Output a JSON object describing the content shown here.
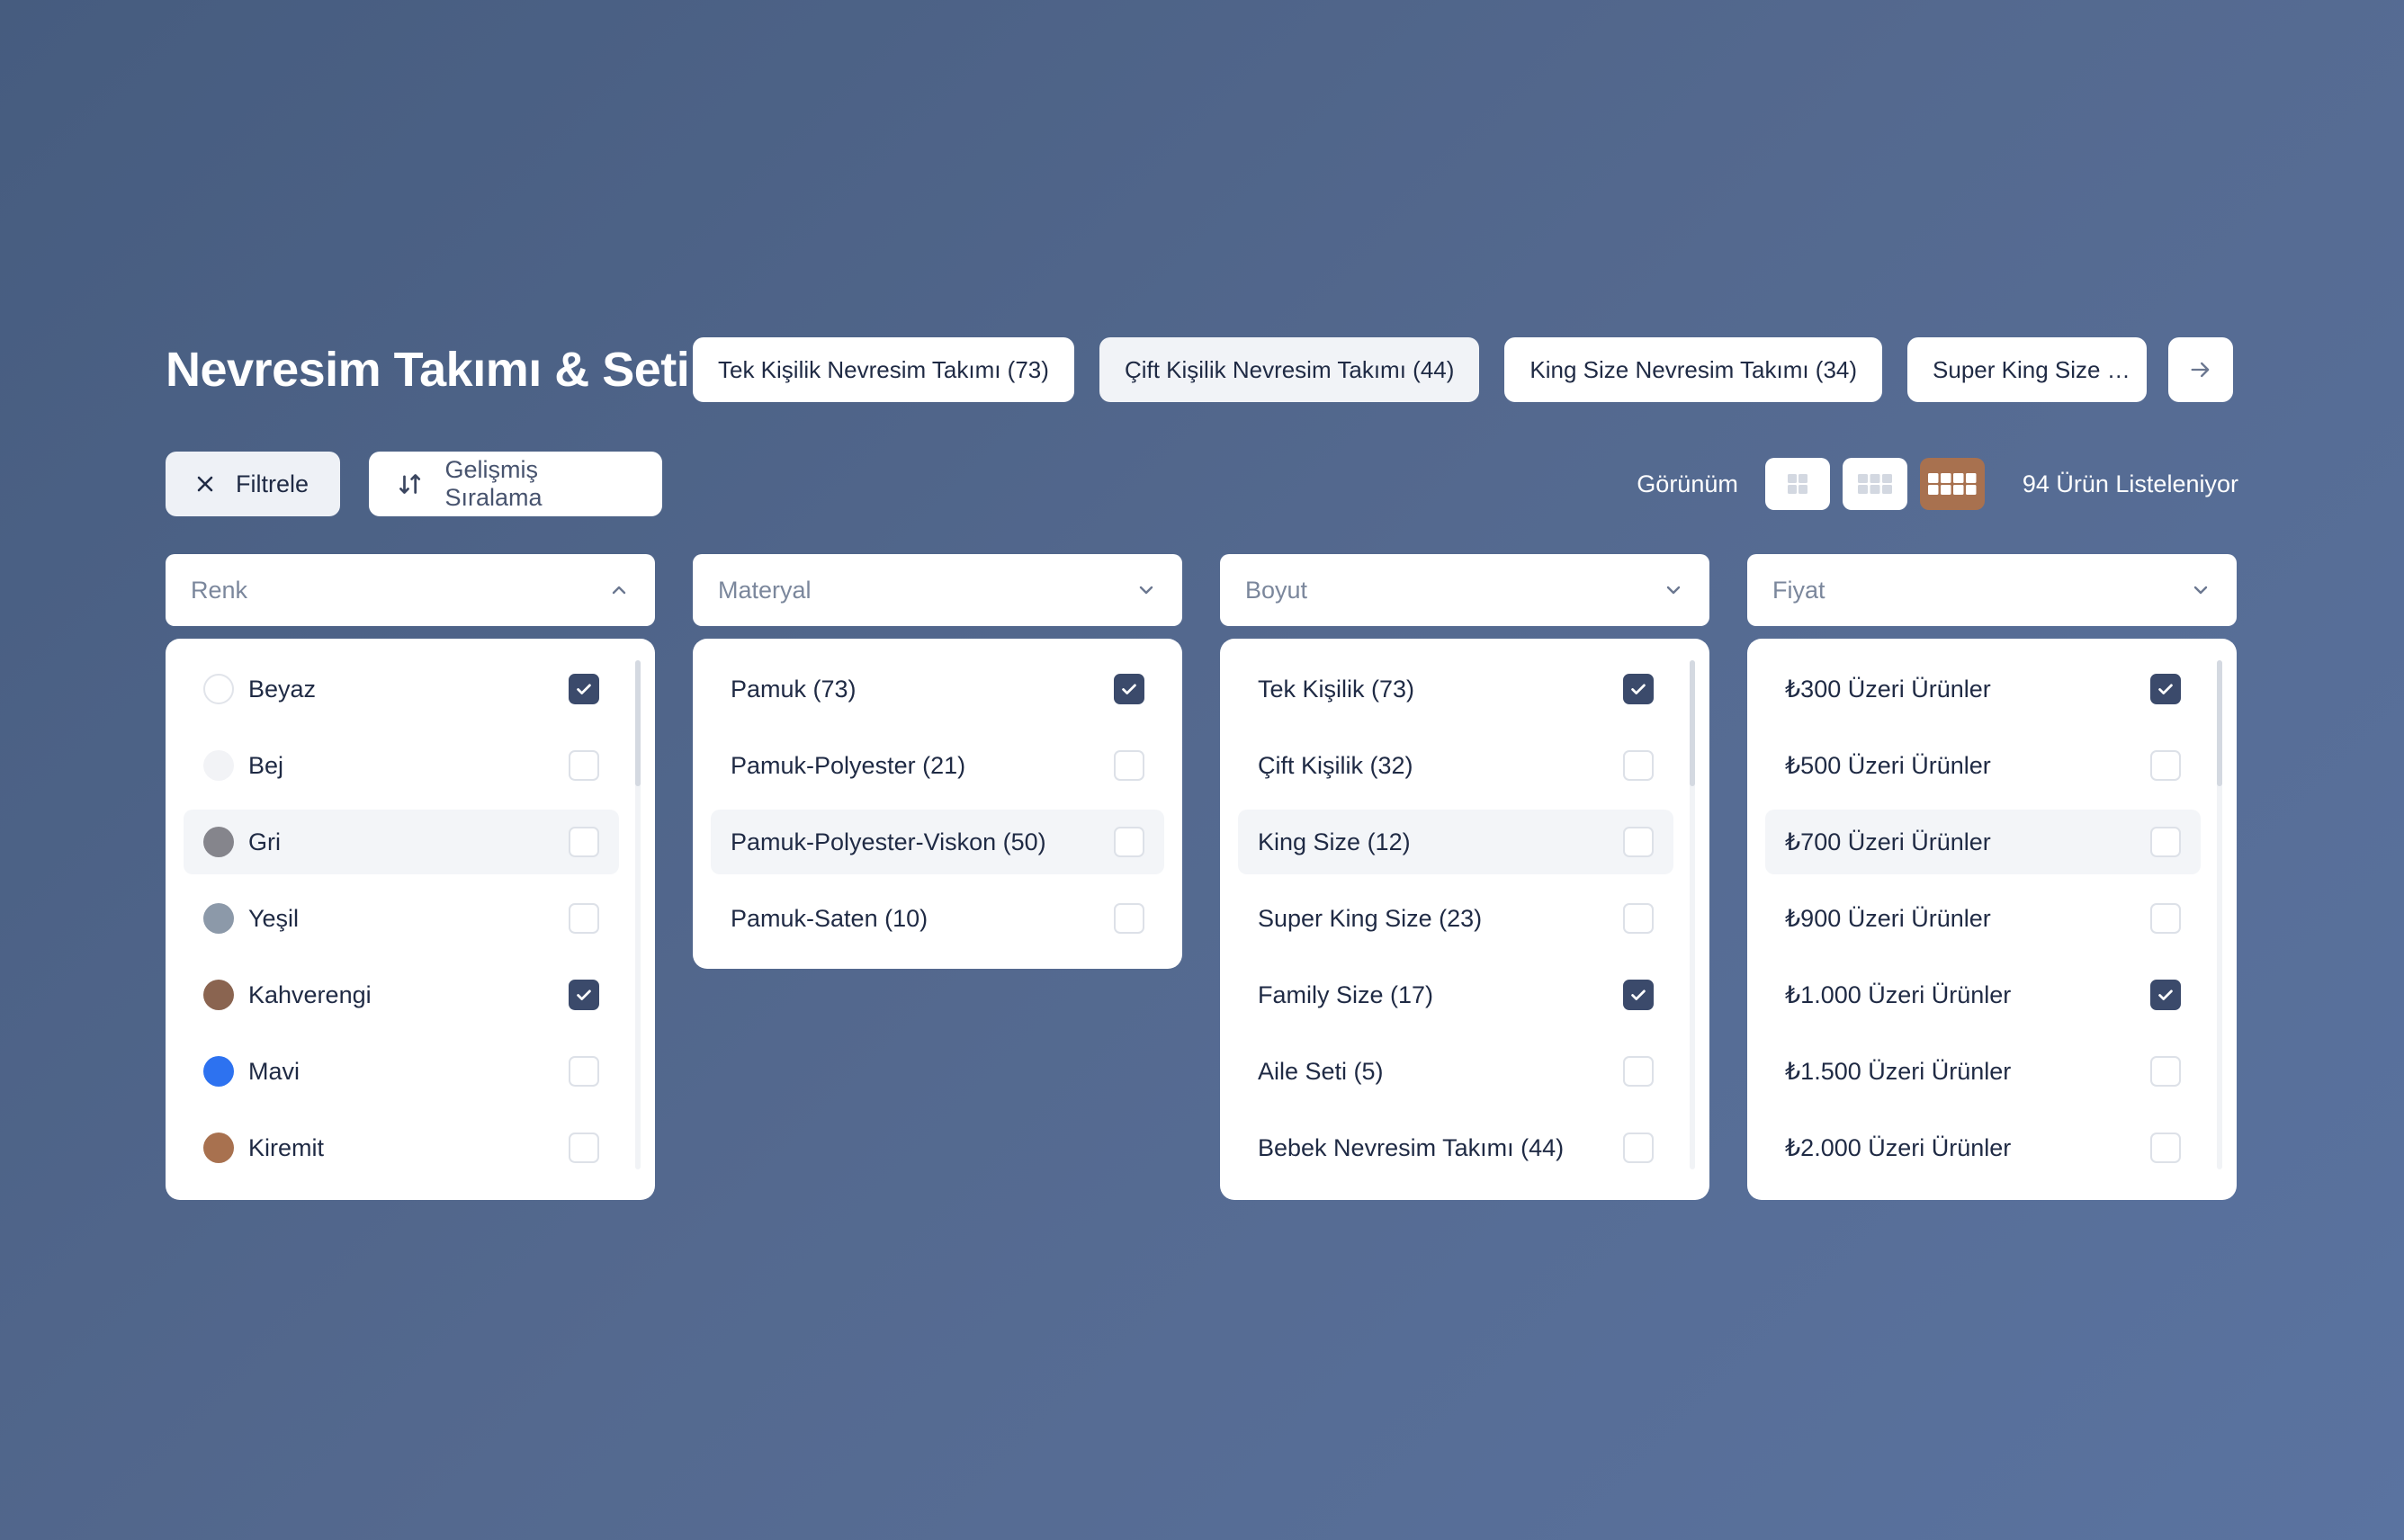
{
  "header": {
    "title": "Nevresim Takımı & Seti",
    "categories": [
      {
        "label": "Tek Kişilik Nevresim Takımı (73)"
      },
      {
        "label": "Çift Kişilik Nevresim Takımı (44)"
      },
      {
        "label": "King Size Nevresim Takımı (34)"
      },
      {
        "label": "Super King Size N..."
      }
    ],
    "next_icon": "arrow-right-icon"
  },
  "toolbar": {
    "filter_label": "Filtrele",
    "sort_label": "Gelişmiş Sıralama",
    "view_label": "Görünüm",
    "view_modes": [
      "grid-2-icon",
      "grid-3-icon",
      "grid-4-icon"
    ],
    "active_view": "grid-4-icon",
    "count_label": "94 Ürün Listeleniyor"
  },
  "filters": {
    "color": {
      "placeholder": "Renk",
      "expanded": true,
      "options": [
        {
          "label": "Beyaz",
          "swatch": "#ffffff",
          "checked": true
        },
        {
          "label": "Bej",
          "swatch": "#f2f3f6",
          "checked": false
        },
        {
          "label": "Gri",
          "swatch": "#85858c",
          "checked": false
        },
        {
          "label": "Yeşil",
          "swatch": "#8c99a9",
          "checked": false
        },
        {
          "label": "Kahverengi",
          "swatch": "#8a6450",
          "checked": true
        },
        {
          "label": "Mavi",
          "swatch": "#2d72f0",
          "checked": false
        },
        {
          "label": "Kiremit",
          "swatch": "#a8714f",
          "checked": false
        }
      ]
    },
    "material": {
      "placeholder": "Materyal",
      "options": [
        {
          "label": "Pamuk (73)",
          "checked": true
        },
        {
          "label": "Pamuk-Polyester (21)",
          "checked": false
        },
        {
          "label": "Pamuk-Polyester-Viskon (50)",
          "checked": false
        },
        {
          "label": "Pamuk-Saten (10)",
          "checked": false
        }
      ]
    },
    "size": {
      "placeholder": "Boyut",
      "options": [
        {
          "label": "Tek Kişilik (73)",
          "checked": true
        },
        {
          "label": "Çift Kişilik (32)",
          "checked": false
        },
        {
          "label": "King Size (12)",
          "checked": false
        },
        {
          "label": "Super King Size (23)",
          "checked": false
        },
        {
          "label": "Family Size (17)",
          "checked": true
        },
        {
          "label": "Aile Seti (5)",
          "checked": false
        },
        {
          "label": "Bebek Nevresim Takımı (44)",
          "checked": false
        }
      ]
    },
    "price": {
      "placeholder": "Fiyat",
      "options": [
        {
          "label": "₺300 Üzeri Ürünler",
          "checked": true
        },
        {
          "label": "₺500 Üzeri Ürünler",
          "checked": false
        },
        {
          "label": "₺700 Üzeri Ürünler",
          "checked": false
        },
        {
          "label": "₺900 Üzeri Ürünler",
          "checked": false
        },
        {
          "label": "₺1.000 Üzeri Ürünler",
          "checked": true
        },
        {
          "label": "₺1.500 Üzeri Ürünler",
          "checked": false
        },
        {
          "label": "₺2.000 Üzeri Ürünler",
          "checked": false
        }
      ]
    }
  },
  "colors": {
    "accent": "#a8714f",
    "checkbox_checked": "#3b4a6b",
    "background": "#4f6388"
  }
}
